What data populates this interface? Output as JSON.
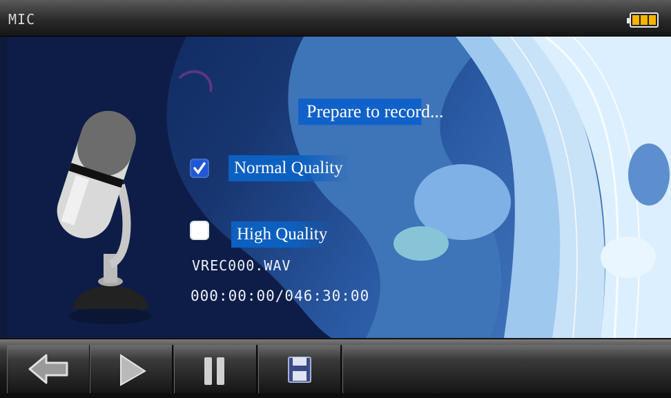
{
  "titlebar": {
    "title": "MIC",
    "battery_icon": "battery-icon",
    "battery_color": "#f5b400"
  },
  "main": {
    "status_text": "Prepare to record...",
    "options": [
      {
        "label": "Normal Quality",
        "checked": true
      },
      {
        "label": "High Quality",
        "checked": false
      }
    ],
    "filename": "VREC000.WAV",
    "timer": "000:00:00/046:30:00",
    "accent_color": "#1061c9"
  },
  "toolbar": {
    "buttons": [
      {
        "icon": "back-arrow-icon"
      },
      {
        "icon": "play-icon"
      },
      {
        "icon": "pause-icon"
      },
      {
        "icon": "save-icon"
      }
    ]
  }
}
